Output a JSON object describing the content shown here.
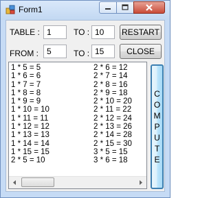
{
  "window": {
    "title": "Form1"
  },
  "controls": {
    "table_label": "TABLE :",
    "table_value": "1",
    "to_label_top": "TO :",
    "to_value_top": "10",
    "restart_label": "RESTART",
    "from_label": "FROM :",
    "from_value": "5",
    "to_label_bottom": "TO :",
    "to_value_bottom": "15",
    "close_label": "CLOSE",
    "compute_letters": [
      "C",
      "O",
      "M",
      "P",
      "U",
      "T",
      "E"
    ]
  },
  "results": {
    "column1": [
      "1 * 5 = 5",
      "1 * 6 = 6",
      "1 * 7 = 7",
      "1 * 8 = 8",
      "1 * 9 = 9",
      "1 * 10 = 10",
      "1 * 11 = 11",
      "1 * 12 = 12",
      "1 * 13 = 13",
      "1 * 14 = 14",
      "1 * 15 = 15",
      "2 * 5 = 10"
    ],
    "column2": [
      "2 * 6 = 12",
      "2 * 7 = 14",
      "2 * 8 = 16",
      "2 * 9 = 18",
      "2 * 10 = 20",
      "2 * 11 = 22",
      "2 * 12 = 24",
      "2 * 13 = 26",
      "2 * 14 = 28",
      "2 * 15 = 30",
      "3 * 5 = 15",
      "3 * 6 = 18"
    ]
  },
  "colors": {
    "frame": "#c6dbf5",
    "close_button": "#c94b38",
    "compute_border": "#3c7fb1"
  }
}
